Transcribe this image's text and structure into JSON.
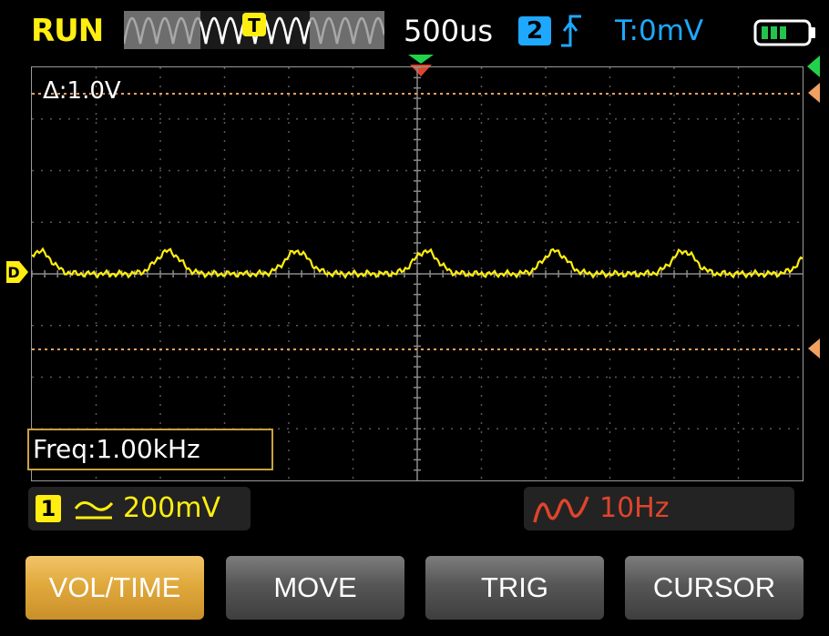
{
  "header": {
    "status": "RUN",
    "timebase": "500us",
    "trigger_source": "2",
    "trigger_edge_icon": "rising-edge-icon",
    "trigger_level": "T:0mV",
    "overview_trigger_label": "T",
    "battery_icon": "battery-icon"
  },
  "plot": {
    "delta_readout": "Δ:1.0V",
    "frequency": "Freq:1.00kHz"
  },
  "channel_info": {
    "ch1_number": "1",
    "ch1_coupling_icon": "dc-coupling-icon",
    "ch1_scale": "200mV",
    "math_icon": "waveform-icon",
    "math_frequency": "10Hz"
  },
  "softkeys": [
    {
      "label": "VOL/TIME",
      "active": true
    },
    {
      "label": "MOVE",
      "active": false
    },
    {
      "label": "TRIG",
      "active": false
    },
    {
      "label": "CURSOR",
      "active": false
    }
  ],
  "colors": {
    "ch1": "#ffee10",
    "ch2": "#1ea8ff",
    "cursor": "#f0a060",
    "math": "#e0442c",
    "trigger_marker": "#22d14a",
    "status": "#ffee10",
    "accent": "#e0a93c"
  }
}
